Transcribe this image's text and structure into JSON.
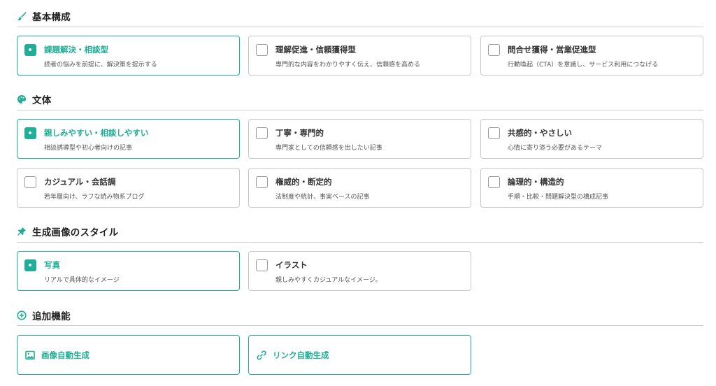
{
  "colors": {
    "accent": "#1fae96",
    "border": "#c9c9c9",
    "text": "#222222",
    "muted": "#555555"
  },
  "sections": {
    "basic": {
      "title": "基本構成",
      "icon": "brush-icon",
      "options": [
        {
          "title": "課題解決・相談型",
          "desc": "読者の悩みを前提に、解決策を提示する",
          "selected": true
        },
        {
          "title": "理解促進・信頼獲得型",
          "desc": "専門的な内容をわかりやすく伝え、信頼感を高める",
          "selected": false
        },
        {
          "title": "問合せ獲得・営業促進型",
          "desc": "行動喚起（CTA）を意識し、サービス利用につなげる",
          "selected": false
        }
      ]
    },
    "style": {
      "title": "文体",
      "icon": "palette-icon",
      "options": [
        {
          "title": "親しみやすい・相談しやすい",
          "desc": "相談誘導型や初心者向けの記事",
          "selected": true
        },
        {
          "title": "丁寧・専門的",
          "desc": "専門家としての信頼感を出したい記事",
          "selected": false
        },
        {
          "title": "共感的・やさしい",
          "desc": "心情に寄り添う必要があるテーマ",
          "selected": false
        },
        {
          "title": "カジュアル・会話調",
          "desc": "若年層向け、ラフな読み物系ブログ",
          "selected": false
        },
        {
          "title": "権威的・断定的",
          "desc": "法制度や統計、事実ベースの記事",
          "selected": false
        },
        {
          "title": "論理的・構造的",
          "desc": "手順・比較・問題解決型の構成記事",
          "selected": false
        }
      ]
    },
    "image_style": {
      "title": "生成画像のスタイル",
      "icon": "pin-icon",
      "options": [
        {
          "title": "写真",
          "desc": "リアルで具体的なイメージ",
          "selected": true
        },
        {
          "title": "イラスト",
          "desc": "親しみやすくカジュアルなイメージ。",
          "selected": false
        }
      ]
    },
    "extras": {
      "title": "追加機能",
      "icon": "plus-circle-icon",
      "features": [
        {
          "label": "画像自動生成",
          "icon": "image-icon"
        },
        {
          "label": "リンク自動生成",
          "icon": "link-icon"
        }
      ]
    }
  }
}
